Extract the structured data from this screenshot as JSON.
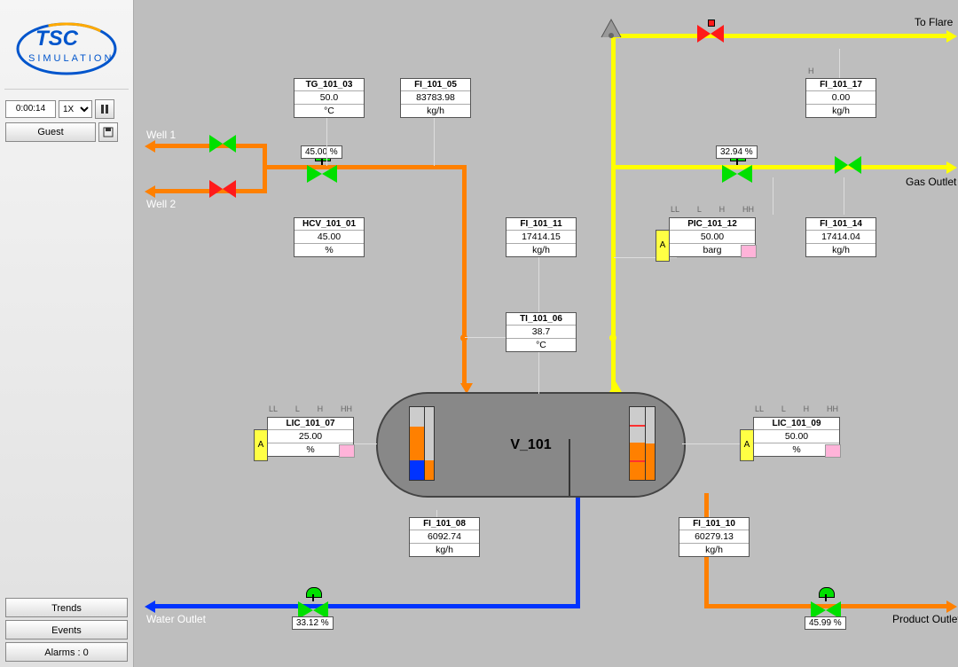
{
  "sim": {
    "time": "0:00:14",
    "speed_selected": "1X",
    "user": "Guest"
  },
  "nav": {
    "trends": "Trends",
    "events": "Events",
    "alarms": "Alarms : 0"
  },
  "labels": {
    "well1": "Well 1",
    "well2": "Well 2",
    "to_flare": "To Flare",
    "gas_outlet": "Gas Outlet",
    "water_outlet": "Water Outlet",
    "product_outlet": "Product Outlet",
    "vessel": "V_101"
  },
  "valves": {
    "hcv_101_01_pct": "45.00 %",
    "pic_gas_pct": "32.94 %",
    "water_cv_pct": "33.12 %",
    "product_cv_pct": "45.99 %"
  },
  "instruments": {
    "TG_101_03": {
      "tag": "TG_101_03",
      "val": "50.0",
      "unit": "°C"
    },
    "FI_101_05": {
      "tag": "FI_101_05",
      "val": "83783.98",
      "unit": "kg/h"
    },
    "FI_101_17": {
      "tag": "FI_101_17",
      "val": "0.00",
      "unit": "kg/h"
    },
    "HCV_101_01": {
      "tag": "HCV_101_01",
      "val": "45.00",
      "unit": "%"
    },
    "FI_101_11": {
      "tag": "FI_101_11",
      "val": "17414.15",
      "unit": "kg/h"
    },
    "FI_101_14": {
      "tag": "FI_101_14",
      "val": "17414.04",
      "unit": "kg/h"
    },
    "TI_101_06": {
      "tag": "TI_101_06",
      "val": "38.7",
      "unit": "°C"
    },
    "FI_101_08": {
      "tag": "FI_101_08",
      "val": "6092.74",
      "unit": "kg/h"
    },
    "FI_101_10": {
      "tag": "FI_101_10",
      "val": "60279.13",
      "unit": "kg/h"
    }
  },
  "controllers": {
    "PIC_101_12": {
      "tag": "PIC_101_12",
      "val": "50.00",
      "unit": "barg",
      "alarms": [
        "LL",
        "L",
        "H",
        "HH"
      ]
    },
    "LIC_101_07": {
      "tag": "LIC_101_07",
      "val": "25.00",
      "unit": "%",
      "alarms": [
        "LL",
        "L",
        "H",
        "HH"
      ]
    },
    "LIC_101_09": {
      "tag": "LIC_101_09",
      "val": "50.00",
      "unit": "%",
      "alarms": [
        "LL",
        "L",
        "H",
        "HH"
      ]
    }
  },
  "colors": {
    "feed": "#ff8000",
    "gas": "#ffff00",
    "water": "#0033ff",
    "valve_open": "#00e000",
    "valve_closed": "#ff1a1a"
  }
}
